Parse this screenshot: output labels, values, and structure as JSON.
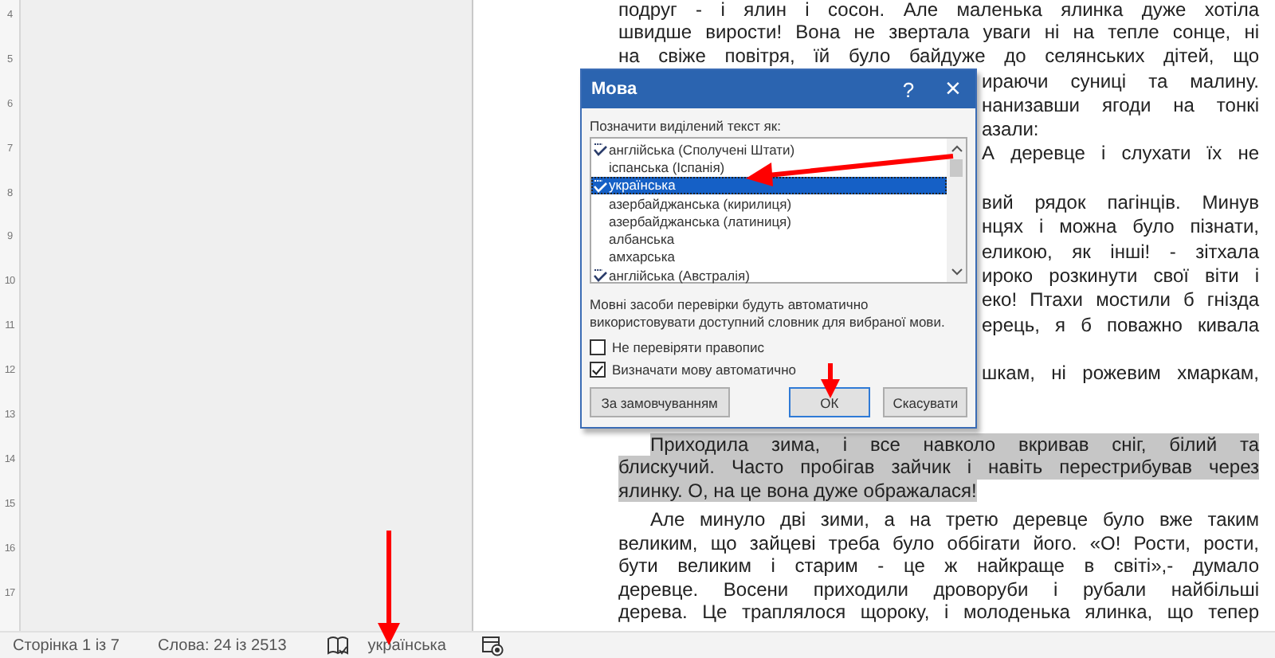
{
  "ruler": {
    "labels": [
      "4",
      "5",
      "6",
      "7",
      "8",
      "9",
      "10",
      "11",
      "12",
      "13",
      "14",
      "15",
      "16",
      "17"
    ]
  },
  "document": {
    "lines": [
      {
        "kind": "full",
        "text": "подруг - і ялин і сосон. Але маленька ялинка дуже хотіла",
        "highlighted": false
      },
      {
        "kind": "full",
        "text": "швидше вирости! Вона не звертала уваги ні на тепле сонце, ні",
        "highlighted": false
      },
      {
        "kind": "full",
        "text": "на свіже повітря, їй було байдуже до селянських дітей, що",
        "highlighted": false
      },
      {
        "kind": "fragment",
        "text": "ираючи суниці та малину.",
        "highlighted": false
      },
      {
        "kind": "fragment",
        "text": "нанизавши ягоди на тонкі",
        "highlighted": false
      },
      {
        "kind": "fragment-end",
        "text": "азали:",
        "highlighted": false
      },
      {
        "kind": "fragment",
        "text": "А деревце і слухати їх не",
        "highlighted": false
      },
      {
        "kind": "covered"
      },
      {
        "kind": "fragment",
        "text": "вий рядок пагінців. Минув",
        "highlighted": false
      },
      {
        "kind": "fragment",
        "text": "нцях і можна було пізнати,",
        "highlighted": false
      },
      {
        "kind": "fragment",
        "text": "еликою, як інші! - зітхала",
        "highlighted": false
      },
      {
        "kind": "fragment",
        "text": "ироко розкинути свої віти і",
        "highlighted": false
      },
      {
        "kind": "fragment",
        "text": "еко! Птахи мостили б гнізда",
        "highlighted": false
      },
      {
        "kind": "fragment",
        "text": "ерець, я б поважно кивала",
        "highlighted": false
      },
      {
        "kind": "covered"
      },
      {
        "kind": "fragment",
        "text": "шкам, ні рожевим хмаркам,",
        "highlighted": false
      },
      {
        "kind": "covered"
      },
      {
        "kind": "full",
        "text": "Приходила зима, і все навколо вкривав сніг, білий та",
        "highlighted": true,
        "gap": true,
        "indent": true
      },
      {
        "kind": "full",
        "text": "блискучий. Часто пробігав зайчик і навіть перестрибував через",
        "highlighted": true
      },
      {
        "kind": "full-end",
        "text": "ялинку. О, на це вона дуже ображалася!",
        "highlighted": true
      },
      {
        "kind": "full",
        "text": "Але минуло дві зими, а на третю деревце було вже таким",
        "highlighted": false,
        "gap": true,
        "indent": true
      },
      {
        "kind": "full",
        "text": "великим, що зайцеві треба було оббігати його. «О! Рости, рости,",
        "highlighted": false
      },
      {
        "kind": "full",
        "text": "бути великим і старим - це ж найкраще в світі»,- думало",
        "highlighted": false
      },
      {
        "kind": "full",
        "text": "деревце. Восени приходили дроворуби і рубали найбільші",
        "highlighted": false
      },
      {
        "kind": "full",
        "text": "дерева. Це траплялося щороку, і молоденька ялинка, що тепер",
        "highlighted": false
      }
    ]
  },
  "dialog": {
    "title": "Мова",
    "help": "?",
    "close": "×",
    "list_label": "Позначити виділений текст як:",
    "languages": [
      {
        "kind": "spell",
        "label": "англійська (Сполучені Штати)",
        "selected": false
      },
      {
        "kind": "plain",
        "label": "іспанська (Іспанія)",
        "selected": false
      },
      {
        "kind": "spell",
        "label": "українська",
        "selected": true
      },
      {
        "kind": "plain",
        "label": "азербайджанська (кирилиця)",
        "selected": false
      },
      {
        "kind": "plain",
        "label": "азербайджанська (латиниця)",
        "selected": false
      },
      {
        "kind": "plain",
        "label": "албанська",
        "selected": false
      },
      {
        "kind": "plain",
        "label": "амхарська",
        "selected": false
      },
      {
        "kind": "spell",
        "label": "англійська (Австралія)",
        "selected": false
      }
    ],
    "note": "Мовні засоби перевірки будуть автоматично використовувати доступний словник для вибраної мови.",
    "checkboxes": [
      {
        "label": "Не перевіряти правопис",
        "checked": false
      },
      {
        "label": "Визначати мову автоматично",
        "checked": true
      }
    ],
    "buttons": [
      {
        "label": "За замовчуванням",
        "default": false
      },
      {
        "label": "ОК",
        "default": true
      },
      {
        "label": "Скасувати",
        "default": false
      }
    ]
  },
  "status_bar": {
    "page": "Сторінка 1 із 7",
    "words": "Слова: 24 із 2513",
    "language": "українська"
  }
}
